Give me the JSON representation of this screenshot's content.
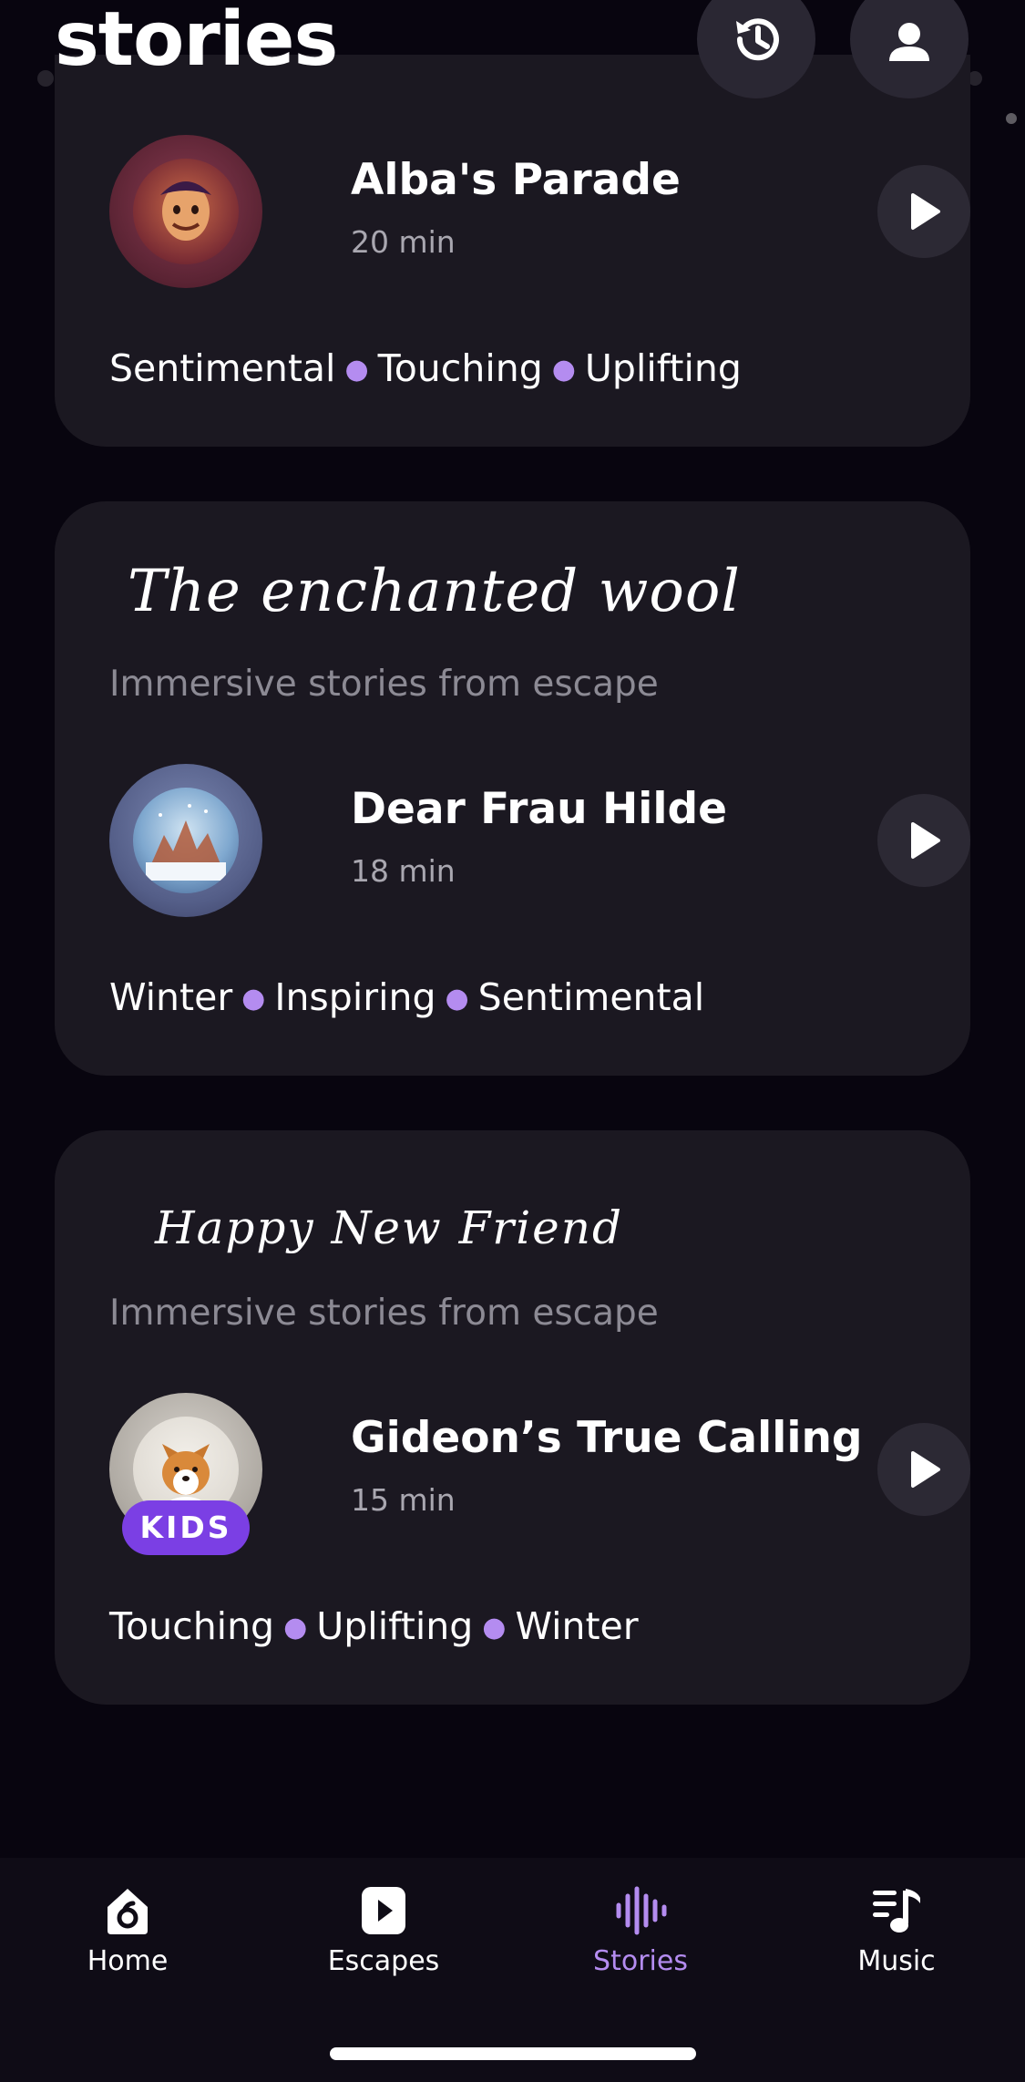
{
  "header": {
    "title": "stories",
    "history_icon": "history-icon",
    "profile_icon": "profile-icon"
  },
  "cards": [
    {
      "collection_title": "",
      "collection_subtitle": "",
      "story": {
        "title": "Alba's Parade",
        "duration": "20 min",
        "kids": false
      },
      "tags": [
        "Sentimental",
        "Touching",
        "Uplifting"
      ]
    },
    {
      "collection_title": "The enchanted wool",
      "collection_subtitle": "Immersive stories from escape",
      "story": {
        "title": "Dear Frau Hilde",
        "duration": "18 min",
        "kids": false
      },
      "tags": [
        "Winter",
        "Inspiring",
        "Sentimental"
      ]
    },
    {
      "collection_title": "Happy New Friend",
      "collection_subtitle": "Immersive stories from escape",
      "story": {
        "title": "Gideon’s True Calling",
        "duration": "15 min",
        "kids": true,
        "badge": "KIDS"
      },
      "tags": [
        "Touching",
        "Uplifting",
        "Winter"
      ]
    }
  ],
  "bottom_nav": {
    "items": [
      {
        "label": "Home",
        "icon": "home-icon",
        "active": false
      },
      {
        "label": "Escapes",
        "icon": "play-square-icon",
        "active": false
      },
      {
        "label": "Stories",
        "icon": "waveform-icon",
        "active": true
      },
      {
        "label": "Music",
        "icon": "music-note-icon",
        "active": false
      }
    ]
  },
  "colors": {
    "background": "#08050f",
    "card": "#1b1821",
    "accent": "#b48cf0",
    "kids_badge": "#7b3fe4",
    "muted_text": "#8c8a94"
  }
}
